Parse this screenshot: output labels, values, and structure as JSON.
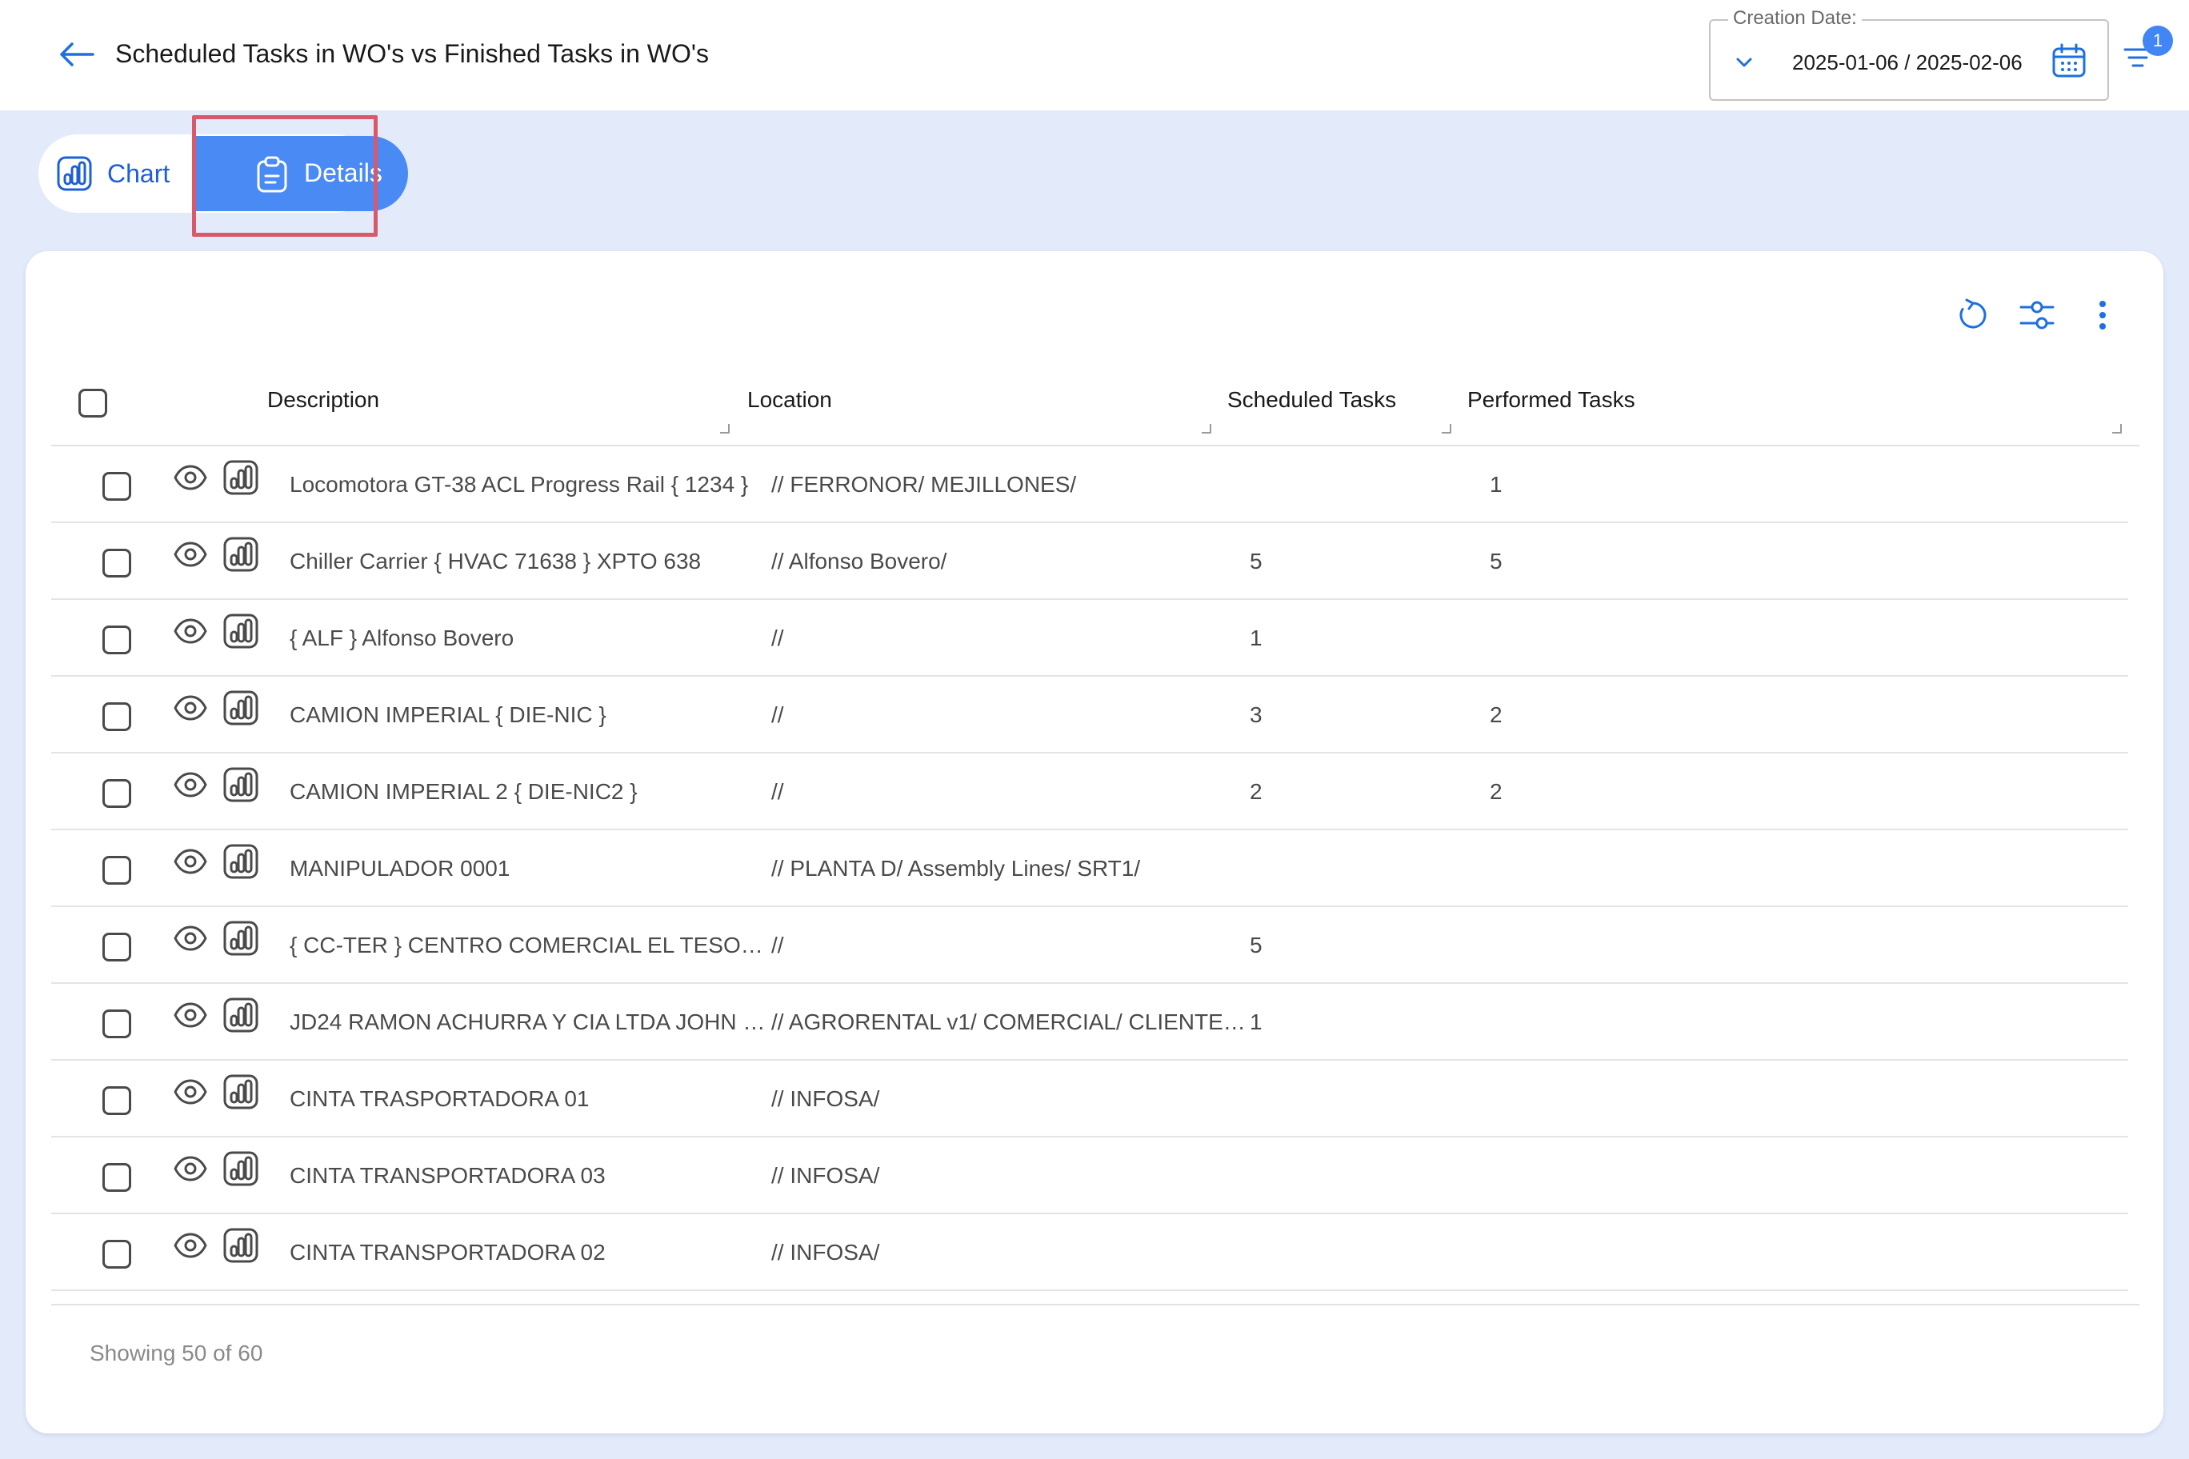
{
  "header": {
    "title": "Scheduled Tasks in WO's vs Finished Tasks in WO's",
    "date_filter": {
      "label": "Creation Date:",
      "value": "2025-01-06 / 2025-02-06"
    },
    "filter_badge_count": "1"
  },
  "view_toggle": {
    "chart_label": "Chart",
    "details_label": "Details",
    "active": "Details"
  },
  "table": {
    "columns": {
      "description": "Description",
      "location": "Location",
      "scheduled": "Scheduled Tasks",
      "performed": "Performed Tasks"
    },
    "rows": [
      {
        "description": "Locomotora GT-38 ACL Progress Rail { 1234 }",
        "location": "// FERRONOR/ MEJILLONES/",
        "scheduled": "",
        "performed": "1"
      },
      {
        "description": "Chiller Carrier { HVAC 71638 } XPTO 638",
        "location": "// Alfonso Bovero/",
        "scheduled": "5",
        "performed": "5"
      },
      {
        "description": "{ ALF } Alfonso Bovero",
        "location": "//",
        "scheduled": "1",
        "performed": ""
      },
      {
        "description": "CAMION IMPERIAL { DIE-NIC }",
        "location": "//",
        "scheduled": "3",
        "performed": "2"
      },
      {
        "description": "CAMION IMPERIAL 2 { DIE-NIC2 }",
        "location": "//",
        "scheduled": "2",
        "performed": "2"
      },
      {
        "description": "MANIPULADOR 0001",
        "location": "// PLANTA D/ Assembly Lines/ SRT1/",
        "scheduled": "",
        "performed": ""
      },
      {
        "description": "{ CC-TER } CENTRO COMERCIAL EL TESORO",
        "location": "//",
        "scheduled": "5",
        "performed": ""
      },
      {
        "description": "JD24 RAMON ACHURRA Y CIA LTDA JOHN …",
        "location": "// AGRORENTAL v1/ COMERCIAL/ CLIENTE…",
        "scheduled": "1",
        "performed": ""
      },
      {
        "description": "CINTA TRASPORTADORA 01",
        "location": "// INFOSA/",
        "scheduled": "",
        "performed": ""
      },
      {
        "description": "CINTA TRANSPORTADORA 03",
        "location": "// INFOSA/",
        "scheduled": "",
        "performed": ""
      },
      {
        "description": "CINTA TRANSPORTADORA 02",
        "location": "// INFOSA/",
        "scheduled": "",
        "performed": ""
      }
    ]
  },
  "footer": {
    "showing": "Showing 50 of 60"
  },
  "colors": {
    "accent": "#4a8af4",
    "link": "#1e5fd6",
    "highlight": "#d9596a",
    "background": "#e3ebfb"
  }
}
